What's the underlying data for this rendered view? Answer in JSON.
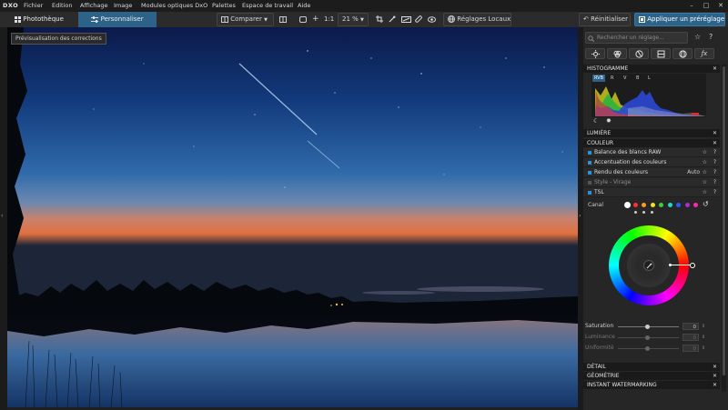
{
  "menubar": {
    "logo": "DXO",
    "items": [
      "Fichier",
      "Edition",
      "Affichage",
      "Image",
      "Modules optiques DxO",
      "Palettes",
      "Espace de travail",
      "Aide"
    ]
  },
  "toolbar": {
    "tabs": [
      "Photothèque",
      "Personnaliser"
    ],
    "compare_label": "Comparer",
    "ratio_label": "1:1",
    "zoom_value": "21 %",
    "local_adjust_label": "Réglages Locaux",
    "reset_label": "Réinitialiser",
    "apply_preset_label": "Appliquer un préréglage"
  },
  "tooltip": "Prévisualisation des corrections",
  "panel": {
    "search_placeholder": "Rechercher un réglage...",
    "histogram_title": "HISTOGRAMME",
    "histogram_channels": [
      "RVB",
      "R",
      "V",
      "B",
      "L"
    ],
    "sections": {
      "lumiere": "LUMIÈRE",
      "couleur": "COULEUR",
      "detail": "DÉTAIL",
      "geometrie": "GÉOMÉTRIE",
      "watermark": "INSTANT WATERMARKING"
    },
    "couleur_rows": [
      {
        "label": "Balance des blancs RAW",
        "value": ""
      },
      {
        "label": "Accentuation des couleurs",
        "value": ""
      },
      {
        "label": "Rendu des couleurs",
        "value": "Auto"
      },
      {
        "label": "Style - Virage",
        "value": ""
      },
      {
        "label": "TSL",
        "value": ""
      }
    ],
    "canal_label": "Canal",
    "canal_colors": [
      "#ffffff",
      "#ff3030",
      "#ff9a1a",
      "#f4e21c",
      "#3ad23a",
      "#1ed8d8",
      "#2a5bff",
      "#b02ad8",
      "#ff2aa6"
    ],
    "sliders": [
      {
        "label": "Saturation",
        "value": "0",
        "level": 0.5,
        "enabled": true
      },
      {
        "label": "Luminance",
        "value": "0",
        "level": 0.5,
        "enabled": false
      },
      {
        "label": "Uniformité",
        "value": "0",
        "level": 0.5,
        "enabled": false
      }
    ]
  }
}
